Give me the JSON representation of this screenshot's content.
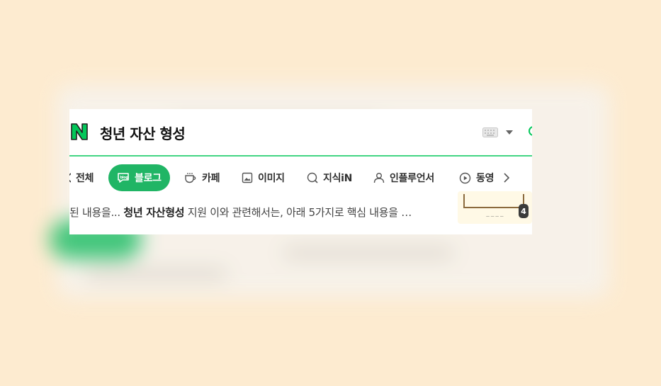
{
  "header": {
    "query": "청년 자산 형성",
    "logo_name": "naver-n-logo",
    "keyboard_icon": "keyboard-icon"
  },
  "tabs": [
    {
      "label": "전체",
      "icon": "all-icon",
      "active": false
    },
    {
      "label": "블로그",
      "icon": "blog-icon",
      "active": true
    },
    {
      "label": "카페",
      "icon": "cafe-icon",
      "active": false
    },
    {
      "label": "이미지",
      "icon": "image-icon",
      "active": false
    },
    {
      "label": "지식iN",
      "icon": "kin-icon",
      "active": false
    },
    {
      "label": "인플루언서",
      "icon": "person-icon",
      "active": false
    },
    {
      "label": "동영",
      "icon": "play-icon",
      "active": false
    }
  ],
  "result": {
    "snippet_before": "된 내용을... ",
    "snippet_bold": "청년 자산형성",
    "snippet_after": " 지원 이와 관련해서는, 아래 5가지로 핵심 내용을 …",
    "image_count": "4"
  },
  "colors": {
    "brand": "#03c75a",
    "active_tab": "#20b565",
    "background": "#fdebd0"
  }
}
